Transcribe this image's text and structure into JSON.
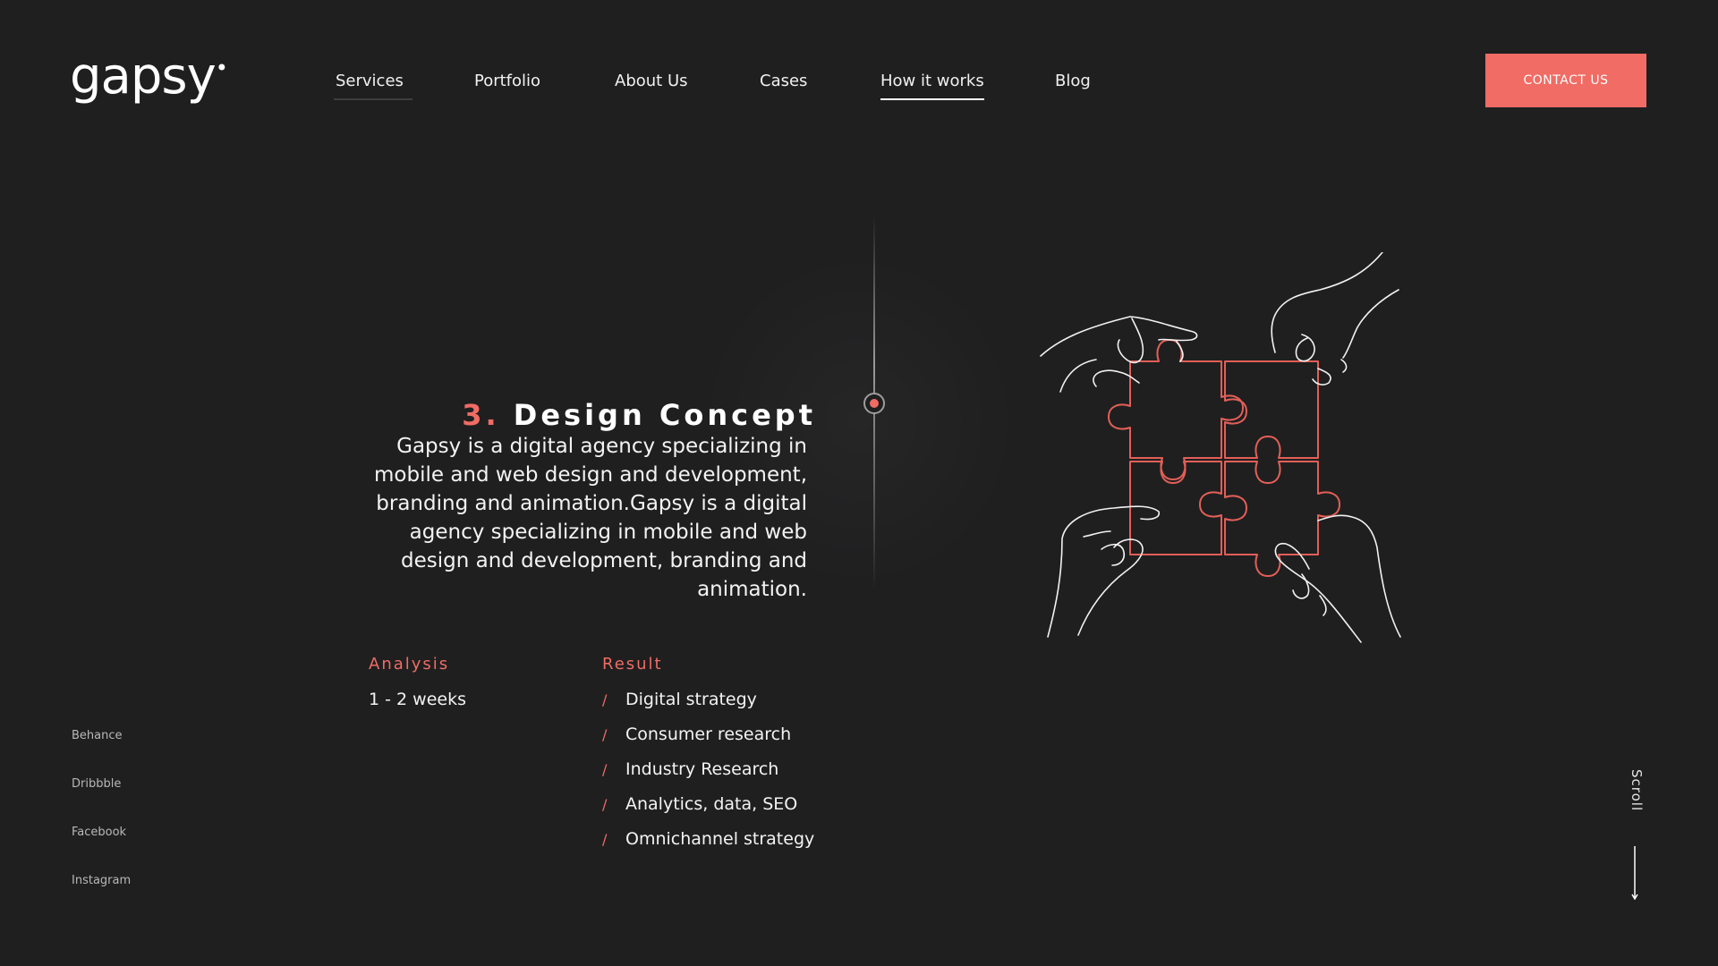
{
  "brand": {
    "logo": "gapsy",
    "accent_color": "#f06c64",
    "background": "#1f1f20"
  },
  "nav": {
    "items": [
      {
        "label": "Services"
      },
      {
        "label": "Portfolio"
      },
      {
        "label": "About Us"
      },
      {
        "label": "Cases"
      },
      {
        "label": "How it works",
        "active": true
      },
      {
        "label": "Blog"
      }
    ],
    "contact_label": "CONTACT US"
  },
  "step": {
    "number": "3.",
    "title": "Design Concept",
    "description": "Gapsy is a digital agency specializing in mobile and web design and development, branding and animation.Gapsy is a digital agency specializing in mobile and web design and development, branding and animation."
  },
  "analysis": {
    "heading": "Analysis",
    "value": "1 - 2 weeks"
  },
  "result": {
    "heading": "Result",
    "items": [
      "Digital strategy",
      "Consumer research",
      "Industry Research",
      "Analytics, data, SEO",
      "Omnichannel strategy"
    ]
  },
  "social": [
    "Behance",
    "Dribbble",
    "Facebook",
    "Instagram"
  ],
  "scroll_label": "Scroll",
  "icons": {
    "illustration": "puzzle-hands-illustration",
    "timeline": "timeline-dot-icon",
    "scroll": "arrow-down-icon"
  }
}
